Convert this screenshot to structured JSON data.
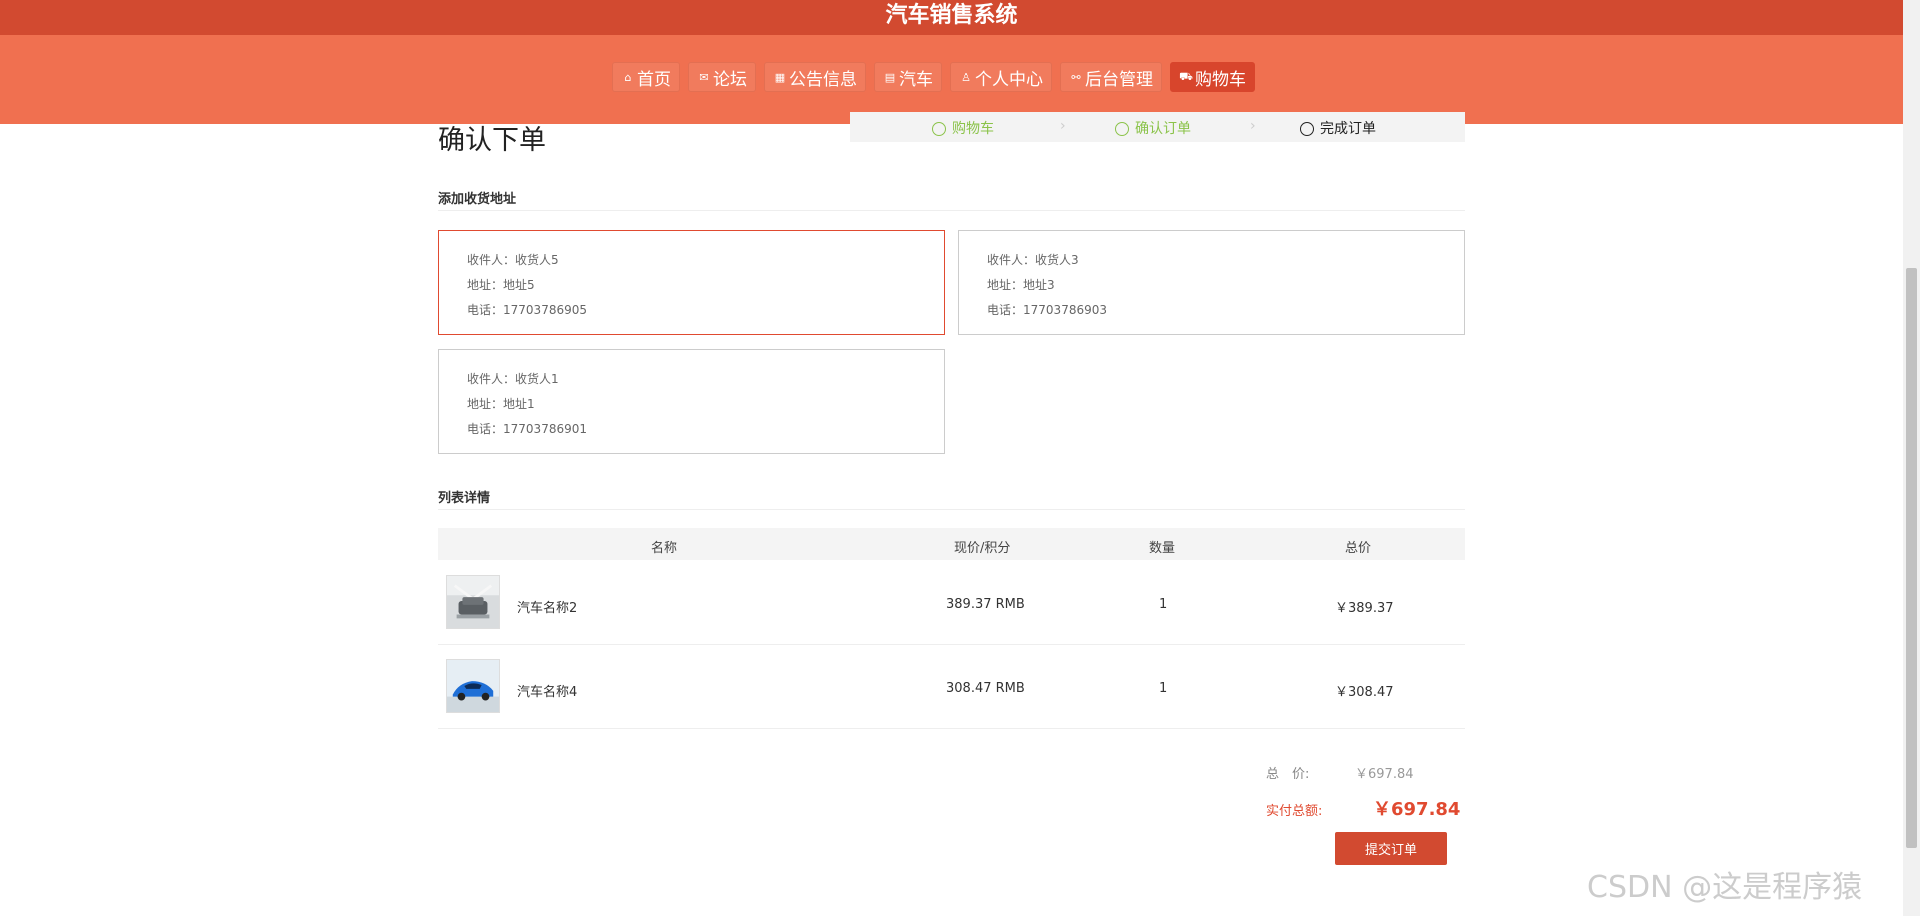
{
  "header": {
    "title": "汽车销售系统"
  },
  "nav": [
    {
      "label": "首页",
      "icon": "home-icon",
      "glyph": "⌂"
    },
    {
      "label": "论坛",
      "icon": "mail-icon",
      "glyph": "✉"
    },
    {
      "label": "公告信息",
      "icon": "notice-icon",
      "glyph": "▦"
    },
    {
      "label": "汽车",
      "icon": "document-icon",
      "glyph": "▤"
    },
    {
      "label": "个人中心",
      "icon": "user-icon",
      "glyph": "♙"
    },
    {
      "label": "后台管理",
      "icon": "link-icon",
      "glyph": "⚯"
    },
    {
      "label": "购物车",
      "icon": "cart-icon",
      "glyph": "⛟",
      "active": true
    }
  ],
  "page": {
    "title": "确认下单",
    "steps": [
      "购物车",
      "确认订单",
      "完成订单"
    ]
  },
  "address_section": {
    "title": "添加收货地址",
    "labels": {
      "receiver": "收件人：",
      "address": "地址：",
      "phone": "电话："
    },
    "cards": [
      {
        "receiver": "收货人5",
        "address": "地址5",
        "phone": "17703786905",
        "selected": true
      },
      {
        "receiver": "收货人3",
        "address": "地址3",
        "phone": "17703786903",
        "selected": false
      },
      {
        "receiver": "收货人1",
        "address": "地址1",
        "phone": "17703786901",
        "selected": false
      }
    ]
  },
  "list_section": {
    "title": "列表详情",
    "columns": [
      "名称",
      "现价/积分",
      "数量",
      "总价"
    ],
    "rows": [
      {
        "name": "汽车名称2",
        "price": "389.37 RMB",
        "qty": "1",
        "total": "￥389.37"
      },
      {
        "name": "汽车名称4",
        "price": "308.47 RMB",
        "qty": "1",
        "total": "￥308.47"
      }
    ]
  },
  "summary": {
    "total_label": "总　价:",
    "total_value": "￥697.84",
    "pay_label": "实付总额:",
    "pay_value": "￥697.84",
    "submit_label": "提交订单"
  },
  "watermark": "CSDN @这是程序猿",
  "colors": {
    "brand": "#d24a30",
    "nav_bg": "#f07050",
    "step_done": "#8bc34a"
  }
}
